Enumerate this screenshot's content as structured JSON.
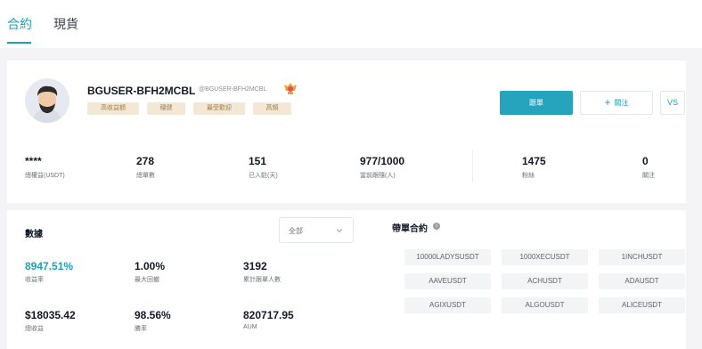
{
  "tabs": [
    {
      "label": "合約",
      "active": true
    },
    {
      "label": "現貨",
      "active": false
    }
  ],
  "profile": {
    "username": "BGUSER-BFH2MCBL",
    "handle": "@BGUSER-BFH2MCBL",
    "tags": [
      "高收益額",
      "穩健",
      "最受歡迎",
      "高頻"
    ],
    "buttons": {
      "copy": "跟單",
      "follow": "關注",
      "vs": "VS"
    },
    "stats": [
      {
        "value": "****",
        "label": "總權益(USDT)"
      },
      {
        "value": "278",
        "label": "總單數"
      },
      {
        "value": "151",
        "label": "已入駐(天)"
      },
      {
        "value": "977/1000",
        "label": "當前跟隨(人)"
      },
      {
        "value": "1475",
        "label": "粉絲"
      },
      {
        "value": "0",
        "label": "關注"
      }
    ]
  },
  "data_section": {
    "title": "數據",
    "select_value": "全部",
    "metrics": [
      {
        "value": "8947.51%",
        "label": "收益率"
      },
      {
        "value": "1.00%",
        "label": "最大回撤"
      },
      {
        "value": "3192",
        "label": "累計跟單人數"
      },
      {
        "value": "$18035.42",
        "label": "總收益"
      },
      {
        "value": "98.56%",
        "label": "勝率"
      },
      {
        "value": "820717.95",
        "label": "AUM"
      }
    ]
  },
  "contracts": {
    "title": "帶單合約",
    "items": [
      "10000LADYSUSDT",
      "1000XECUSDT",
      "1INCHUSDT",
      "AAVEUSDT",
      "ACHUSDT",
      "ADAUSDT",
      "AGIXUSDT",
      "ALGOUSDT",
      "ALICEUSDT"
    ]
  },
  "colors": {
    "accent": "#1fa0b3",
    "button": "#26a3bd",
    "tag_bg": "#f3e8d6",
    "tag_text": "#a67c3e"
  }
}
